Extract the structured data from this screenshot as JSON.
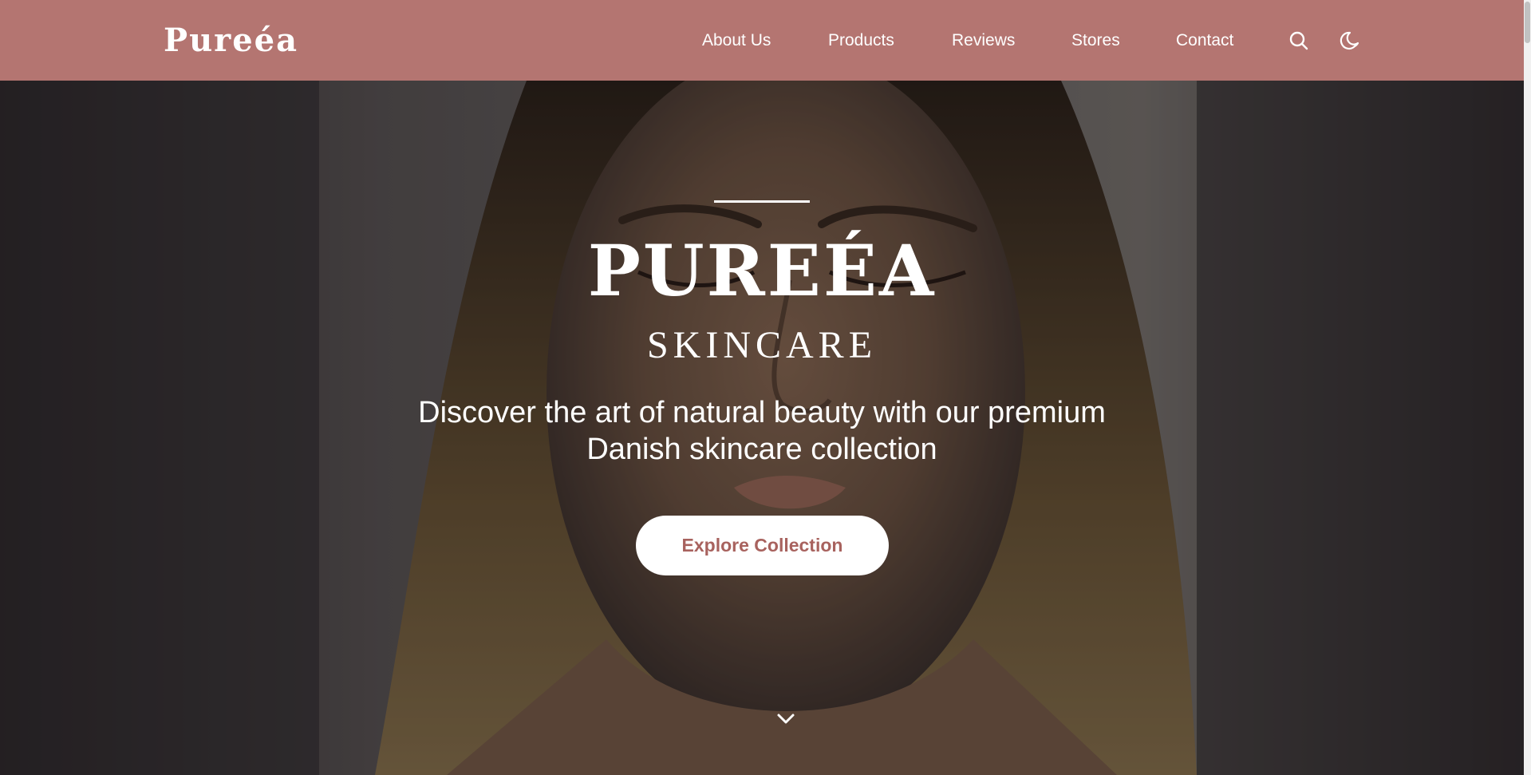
{
  "brand": {
    "logo": "Pureéa"
  },
  "nav": {
    "items": [
      {
        "id": "about",
        "label": "About Us"
      },
      {
        "id": "products",
        "label": "Products"
      },
      {
        "id": "reviews",
        "label": "Reviews"
      },
      {
        "id": "stores",
        "label": "Stores"
      },
      {
        "id": "contact",
        "label": "Contact"
      }
    ],
    "icons": [
      "search-icon",
      "moon-icon"
    ]
  },
  "hero": {
    "title": "PUREÉA",
    "subtitle": "SKINCARE",
    "description_line1": "Discover the art of natural beauty with our premium",
    "description_line2": "Danish skincare collection",
    "cta_label": "Explore Collection",
    "scroll_icon": "chevron-down-icon"
  },
  "colors": {
    "header_bg": "#b47571",
    "cta_text": "#a8625e",
    "text_light": "#ffffff"
  }
}
